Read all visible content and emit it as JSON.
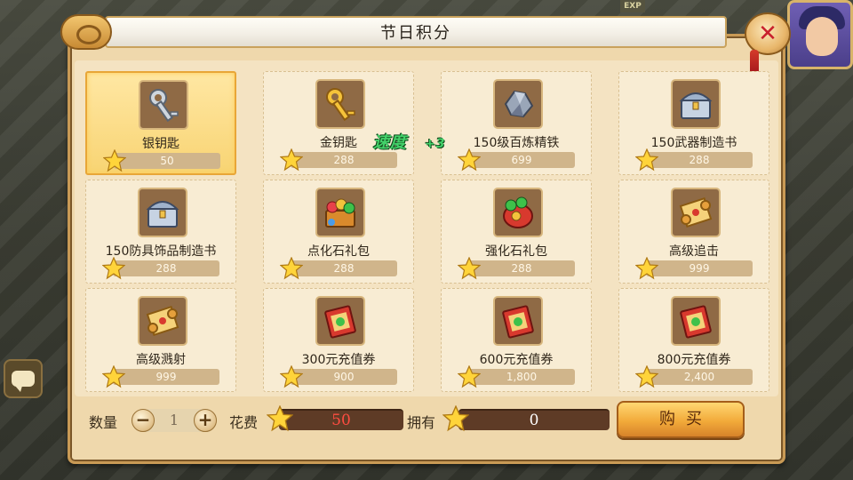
{
  "window": {
    "title": "节日积分"
  },
  "background": {
    "exp_label": "EXP"
  },
  "items": [
    {
      "name": "银钥匙",
      "price": "50",
      "icon": "silver-key-icon",
      "selected": true
    },
    {
      "name": "金钥匙",
      "price": "288",
      "icon": "gold-key-icon"
    },
    {
      "name": "150级百炼精铁",
      "price": "699",
      "icon": "refined-iron-icon"
    },
    {
      "name": "150武器制造书",
      "price": "288",
      "icon": "treasure-chest-icon"
    },
    {
      "name": "150防具饰品制造书",
      "price": "288",
      "icon": "treasure-chest-icon"
    },
    {
      "name": "点化石礼包",
      "price": "288",
      "icon": "gem-chest-icon"
    },
    {
      "name": "强化石礼包",
      "price": "288",
      "icon": "gem-bag-icon"
    },
    {
      "name": "高级追击",
      "price": "999",
      "icon": "scroll-icon"
    },
    {
      "name": "高级溅射",
      "price": "999",
      "icon": "scroll-icon"
    },
    {
      "name": "300元充值券",
      "price": "900",
      "icon": "recharge-voucher-icon"
    },
    {
      "name": "600元充值券",
      "price": "1,800",
      "icon": "recharge-voucher-icon"
    },
    {
      "name": "800元充值券",
      "price": "2,400",
      "icon": "recharge-voucher-icon"
    }
  ],
  "float_buff": {
    "label": "速度",
    "value": "+3"
  },
  "bottom": {
    "quantity_label": "数量",
    "quantity_value": "1",
    "cost_label": "花费",
    "cost_value": "50",
    "own_label": "拥有",
    "own_value": "0",
    "buy_label": "购买"
  },
  "colors": {
    "panel": "#efd8ac",
    "selected_card": "#f8d473",
    "cost_text": "#ff4c40",
    "buff_text": "#43d16a",
    "close_x": "#c8202c"
  }
}
